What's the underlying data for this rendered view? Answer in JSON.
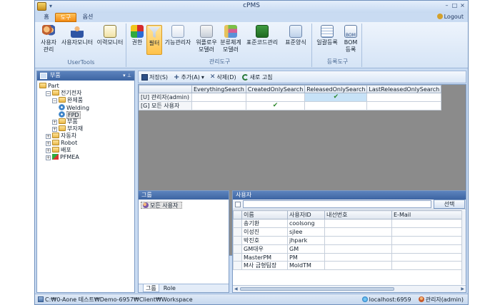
{
  "window": {
    "title": "cPMS",
    "logout": "Logout"
  },
  "tabs": [
    {
      "label": "홈"
    },
    {
      "label": "도구"
    },
    {
      "label": "옵션"
    }
  ],
  "ribbon": {
    "usertools": {
      "label": "UserTools",
      "buttons": [
        {
          "label1": "사용자",
          "label2": "관리"
        },
        {
          "label1": "사용자모니터",
          "label2": ""
        },
        {
          "label1": "이력모니터",
          "label2": ""
        }
      ]
    },
    "admin": {
      "label": "관리도구",
      "buttons": [
        {
          "label1": "권한",
          "label2": ""
        },
        {
          "label1": "필터",
          "label2": ""
        },
        {
          "label1": "기능관리자",
          "label2": ""
        },
        {
          "label1": "워플로우",
          "label2": "모델러"
        },
        {
          "label1": "분류체계",
          "label2": "모델러"
        },
        {
          "label1": "표준코드관리",
          "label2": ""
        },
        {
          "label1": "표준양식",
          "label2": ""
        }
      ]
    },
    "register": {
      "label": "등록도구",
      "buttons": [
        {
          "label1": "일괄등록",
          "label2": ""
        },
        {
          "label1": "BOM",
          "label2": "등록",
          "icon_text": "BOM"
        }
      ]
    }
  },
  "left_panel": {
    "title": "부품",
    "tree": [
      {
        "label": "Part",
        "level": 0,
        "toggle": "",
        "icon": "folder"
      },
      {
        "label": "전기전자",
        "level": 1,
        "toggle": "−",
        "icon": "folder"
      },
      {
        "label": "완제품",
        "level": 2,
        "toggle": "−",
        "icon": "folder"
      },
      {
        "label": "Welding",
        "level": 3,
        "toggle": "",
        "icon": "gear"
      },
      {
        "label": "FPD",
        "level": 3,
        "toggle": "",
        "icon": "gear",
        "selected": true
      },
      {
        "label": "부품",
        "level": 2,
        "toggle": "+",
        "icon": "folder"
      },
      {
        "label": "부자재",
        "level": 2,
        "toggle": "+",
        "icon": "folder"
      },
      {
        "label": "자동차",
        "level": 1,
        "toggle": "+",
        "icon": "folder"
      },
      {
        "label": "Robot",
        "level": 1,
        "toggle": "+",
        "icon": "folder"
      },
      {
        "label": "배포",
        "level": 1,
        "toggle": "+",
        "icon": "folder"
      },
      {
        "label": "PFMEA",
        "level": 1,
        "toggle": "+",
        "icon": "tag"
      }
    ]
  },
  "toolbar": {
    "save": "저장(S)",
    "add": "추가(A)",
    "delete": "삭제(D)",
    "refresh": "새로 고침"
  },
  "filter_grid": {
    "columns": [
      "",
      "EverythingSearch",
      "CreatedOnlySearch",
      "ReleasedOnlySearch",
      "LastReleasedOnlySearch"
    ],
    "rows": [
      {
        "name": "[U] 관리자(admin)",
        "checks": [
          false,
          false,
          true,
          false
        ]
      },
      {
        "name": "[G] 모든 사용자",
        "checks": [
          false,
          true,
          false,
          false
        ]
      }
    ],
    "check_glyph": "✔"
  },
  "group_panel": {
    "title": "그룹",
    "items": [
      "모든 사용자"
    ],
    "tabs": [
      "그룹",
      "Role"
    ]
  },
  "user_panel": {
    "title": "사용자",
    "filter_placeholder": "",
    "select_button": "선택",
    "columns": [
      "이름",
      "사용자ID",
      "내선번호",
      "E-Mail"
    ],
    "rows": [
      [
        "송기환",
        "coolsong",
        "",
        ""
      ],
      [
        "이성진",
        "sjlee",
        "",
        ""
      ],
      [
        "박진호",
        "jhpark",
        "",
        ""
      ],
      [
        "GM대우",
        "GM",
        "",
        ""
      ],
      [
        "MasterPM",
        "PM",
        "",
        ""
      ],
      [
        "M사 금형팀장",
        "MoldTM",
        "",
        ""
      ]
    ]
  },
  "statusbar": {
    "path": "C:₩0-Aone 테스트₩Demo-6957₩Client₩Workspace",
    "server": "localhost:6959",
    "user": "관리자(admin)"
  }
}
